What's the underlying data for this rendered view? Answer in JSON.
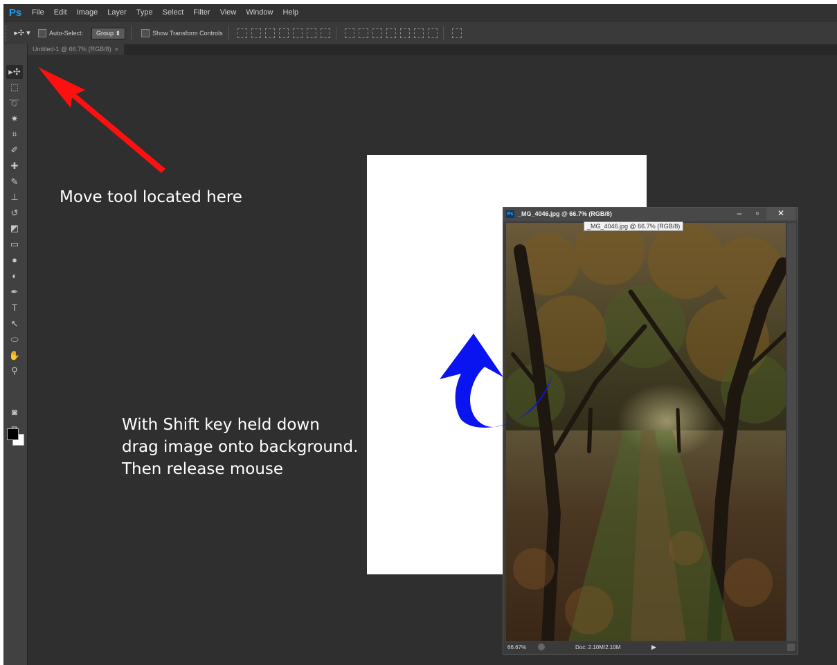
{
  "app": {
    "logo": "Ps"
  },
  "menu": [
    "File",
    "Edit",
    "Image",
    "Layer",
    "Type",
    "Select",
    "Filter",
    "View",
    "Window",
    "Help"
  ],
  "options_bar": {
    "tool_glyph": "▸✣ ▾",
    "auto_select_label": "Auto-Select:",
    "group_value": "Group",
    "group_arrow": "⬍",
    "show_transform_label": "Show Transform Controls"
  },
  "document_tab": {
    "title": "Untitled-1 @ 66.7% (RGB/8)",
    "close": "×"
  },
  "toolbox": {
    "tools": [
      {
        "name": "move",
        "glyph": "▸✣"
      },
      {
        "name": "marquee",
        "glyph": "⬚"
      },
      {
        "name": "lasso",
        "glyph": "➰"
      },
      {
        "name": "magic-wand",
        "glyph": "✷"
      },
      {
        "name": "crop",
        "glyph": "⌗"
      },
      {
        "name": "eyedropper",
        "glyph": "✐"
      },
      {
        "name": "healing",
        "glyph": "✚"
      },
      {
        "name": "brush",
        "glyph": "✎"
      },
      {
        "name": "stamp",
        "glyph": "⊥"
      },
      {
        "name": "history-brush",
        "glyph": "↺"
      },
      {
        "name": "eraser",
        "glyph": "◩"
      },
      {
        "name": "gradient",
        "glyph": "▭"
      },
      {
        "name": "blur",
        "glyph": "●"
      },
      {
        "name": "dodge",
        "glyph": "◐"
      },
      {
        "name": "pen",
        "glyph": "✒"
      },
      {
        "name": "type",
        "glyph": "T"
      },
      {
        "name": "path-selection",
        "glyph": "↖"
      },
      {
        "name": "shape",
        "glyph": "⬭"
      },
      {
        "name": "hand",
        "glyph": "✋"
      },
      {
        "name": "zoom",
        "glyph": "⚲"
      }
    ],
    "bottom": [
      {
        "name": "quick-mask",
        "glyph": "◙"
      },
      {
        "name": "screen-mode",
        "glyph": "⧉"
      }
    ]
  },
  "annotations": {
    "move_tool": "Move tool located here",
    "drag_lines": [
      "With Shift key held down",
      "drag image onto background.",
      "Then release mouse"
    ]
  },
  "image_window": {
    "ps_badge": "Ps",
    "title": "_MG_4046.jpg @ 66.7% (RGB/8)",
    "tooltip": "_MG_4046.jpg @ 66.7% (RGB/8)",
    "minimize": "–",
    "maximize": "▫",
    "close": "✕",
    "zoom": "66.67%",
    "doc_size": "Doc: 2.10M/2.10M",
    "arrow": "▶"
  },
  "colors": {
    "red_arrow": "#ff1010",
    "blue_arrow": "#0a14f0",
    "workspace": "#2f2f2f"
  }
}
